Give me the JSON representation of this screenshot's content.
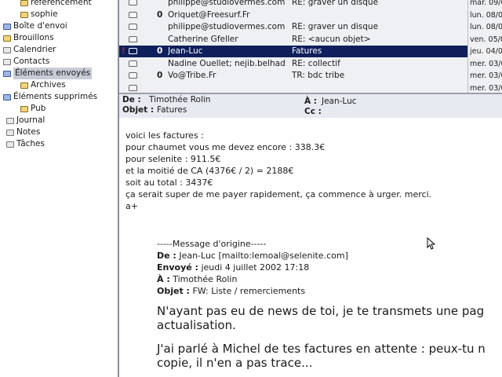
{
  "folders": [
    {
      "label": "referencement",
      "icon": "folder-icon"
    },
    {
      "label": "sophie",
      "icon": "folder-icon"
    },
    {
      "label": "Boîte d'envoi",
      "icon": "outbox-icon"
    },
    {
      "label": "Brouillons",
      "icon": "drafts-icon"
    },
    {
      "label": "Calendrier",
      "icon": "calendar-icon"
    },
    {
      "label": "Contacts",
      "icon": "contacts-icon"
    },
    {
      "label": "Éléments envoyés",
      "icon": "sent-icon"
    },
    {
      "label": "Archives",
      "icon": "folder-icon"
    },
    {
      "label": "Éléments supprimés",
      "icon": "trash-icon"
    },
    {
      "label": "Pub",
      "icon": "folder-icon"
    },
    {
      "label": "Journal",
      "icon": "journal-icon"
    },
    {
      "label": "Notes",
      "icon": "notes-icon"
    },
    {
      "label": "Tâches",
      "icon": "tasks-icon"
    }
  ],
  "selected_folder": "Éléments envoyés",
  "messages": [
    {
      "from": "philippe@studiovermes.com",
      "subject": "RE: graver un disque",
      "date": "mar. 09/0",
      "attachment": false,
      "flag": false
    },
    {
      "from": "Oriquet@Freesurf.Fr",
      "subject": "",
      "date": "lun. 08/0",
      "attachment": true,
      "flag": false
    },
    {
      "from": "philippe@studiovermes.com",
      "subject": "RE: graver un disque",
      "date": "lun. 08/0",
      "attachment": false,
      "flag": false
    },
    {
      "from": "Catherine Gfeller",
      "subject": "RE: <aucun objet>",
      "date": "ven. 05/0",
      "attachment": false,
      "flag": false
    },
    {
      "from": "Jean-Luc",
      "subject": "Fatures",
      "date": "jeu. 04/0",
      "attachment": true,
      "flag": true
    },
    {
      "from": "Nadine Ouellet; nejib.belhad...",
      "subject": "RE: collectif",
      "date": "mer. 03/0",
      "attachment": false,
      "flag": false
    },
    {
      "from": "Vo@Tribe.Fr",
      "subject": "TR: bdc tribe",
      "date": "mer. 03/0",
      "attachment": true,
      "flag": false
    },
    {
      "from": "",
      "subject": "",
      "date": "mer. 03/0",
      "attachment": false,
      "flag": false
    }
  ],
  "reading_header": {
    "from_label": "De :",
    "from_value": "Timothée Rolin",
    "to_label": "À :",
    "to_value": "Jean-Luc",
    "subject_label": "Objet :",
    "subject_value": "Fatures",
    "cc_label": "Cc :",
    "cc_value": ""
  },
  "body_lines": [
    "voici les factures :",
    "pour chaumet vous me devez encore : 338.3€",
    "pour selenite : 911.5€",
    "et la moitié de CA (4376€ / 2) =  2188€",
    "soit au total : 3437€",
    "ça serait super de me payer rapidement, ça commence à urger. merci.",
    "a+"
  ],
  "original_message": {
    "separator": "-----Message d'origine-----",
    "from_label": "De :",
    "from_value": "Jean-Luc [mailto:lemoal@selenite.com]",
    "sent_label": "Envoyé :",
    "sent_value": "jeudi 4 juillet 2002 17:18",
    "to_label": "À :",
    "to_value": "Timothée Rolin",
    "subject_label": "Objet :",
    "subject_value": "FW: Liste / remerciements"
  },
  "quoted_lines": [
    "N'ayant pas eu de news de toi, je te transmets une pag",
    "actualisation.",
    "J'ai parlé à Michel de tes factures en attente : peux-tu n",
    "copie, il n'en a pas trace..."
  ],
  "colors": {
    "selection": "#0f1f5c",
    "flag": "#c0262e",
    "folder_pane_bg": "#ffffff",
    "list_bg": "#eef0f4"
  }
}
